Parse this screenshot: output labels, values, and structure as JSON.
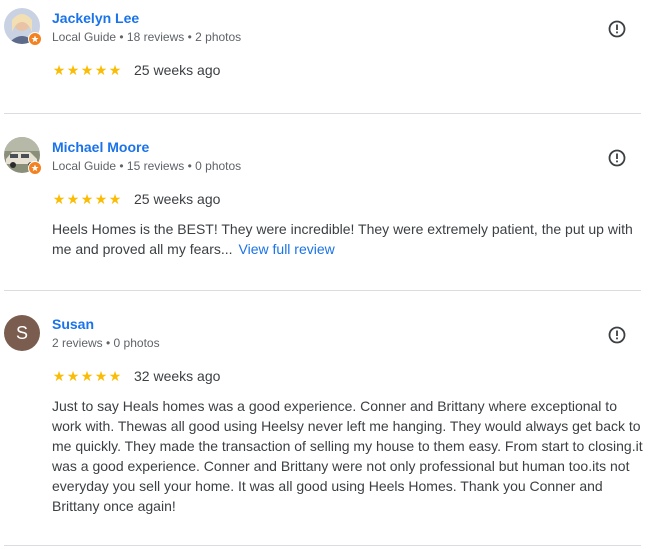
{
  "reviews": [
    {
      "name": "Jackelyn Lee",
      "meta": "Local Guide • 18 reviews • 2 photos",
      "rating_text": "★★★★★",
      "rating": 5,
      "when": "25 weeks ago",
      "text": "",
      "more": ""
    },
    {
      "name": "Michael Moore",
      "meta": "Local Guide • 15 reviews • 0 photos",
      "rating_text": "★★★★★",
      "rating": 5,
      "when": "25 weeks ago",
      "text": "Heels Homes is the BEST! They were incredible! They were extremely patient, the put up with me and proved all my fears...",
      "more": "View full review"
    },
    {
      "name": "Susan",
      "avatar_letter": "S",
      "meta": "2 reviews • 0 photos",
      "rating_text": "★★★★★",
      "rating": 5,
      "when": "32 weeks ago",
      "text": "Just to say Heals homes was a good experience. Conner and Brittany where exceptional to work with. Thewas all good using Heelsy never left me hanging. They would always get back to me quickly. They made the transaction of selling my house to them easy. From start to closing.it was a good experience. Conner and Brittany were not only professional but human too.its not everyday you sell your home. It was all good using Heels Homes. Thank you Conner and Brittany once again!",
      "more": ""
    }
  ],
  "colors": {
    "name": "#1a73e8",
    "star": "#fbbc04",
    "badge": "#f4811f",
    "divider": "#dadce0",
    "avatar_s": "#7b5d50"
  },
  "icons": {
    "flag": "report-flag-icon",
    "badge": "local-guide-badge-icon"
  }
}
